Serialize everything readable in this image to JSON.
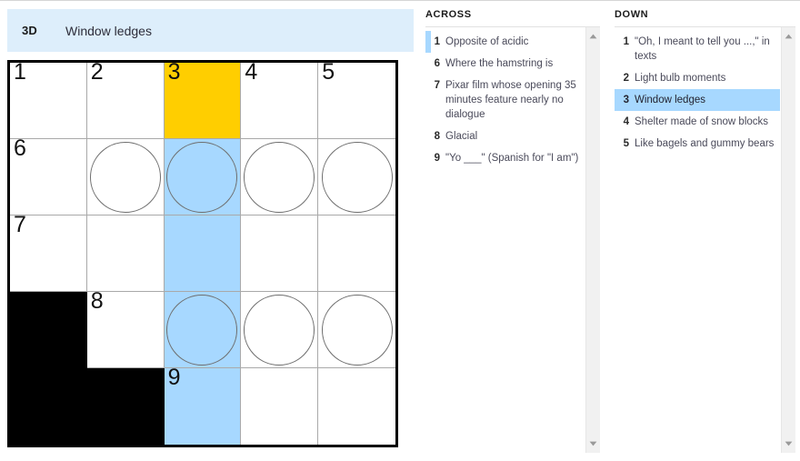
{
  "current_clue": {
    "label": "3D",
    "text": "Window ledges"
  },
  "colors": {
    "clue_bar_background": "#DDEEFB",
    "active_cell": "#FFCE00",
    "active_word": "#A7D8FF",
    "block_cell": "#000000",
    "grid_border": "#000000",
    "grid_line": "#A9A9A9"
  },
  "grid": {
    "rows": 5,
    "cols": 5,
    "cells": [
      [
        {
          "number": "1",
          "state": "open",
          "circle": false,
          "letter": ""
        },
        {
          "number": "2",
          "state": "open",
          "circle": false,
          "letter": ""
        },
        {
          "number": "3",
          "state": "active",
          "circle": false,
          "letter": ""
        },
        {
          "number": "4",
          "state": "open",
          "circle": false,
          "letter": ""
        },
        {
          "number": "5",
          "state": "open",
          "circle": false,
          "letter": ""
        }
      ],
      [
        {
          "number": "6",
          "state": "open",
          "circle": false,
          "letter": ""
        },
        {
          "number": "",
          "state": "open",
          "circle": true,
          "letter": ""
        },
        {
          "number": "",
          "state": "word",
          "circle": true,
          "letter": ""
        },
        {
          "number": "",
          "state": "open",
          "circle": true,
          "letter": ""
        },
        {
          "number": "",
          "state": "open",
          "circle": true,
          "letter": ""
        }
      ],
      [
        {
          "number": "7",
          "state": "open",
          "circle": false,
          "letter": ""
        },
        {
          "number": "",
          "state": "open",
          "circle": false,
          "letter": ""
        },
        {
          "number": "",
          "state": "word",
          "circle": false,
          "letter": ""
        },
        {
          "number": "",
          "state": "open",
          "circle": false,
          "letter": ""
        },
        {
          "number": "",
          "state": "open",
          "circle": false,
          "letter": ""
        }
      ],
      [
        {
          "number": "",
          "state": "block",
          "circle": false,
          "letter": ""
        },
        {
          "number": "8",
          "state": "open",
          "circle": false,
          "letter": ""
        },
        {
          "number": "",
          "state": "word",
          "circle": true,
          "letter": ""
        },
        {
          "number": "",
          "state": "open",
          "circle": true,
          "letter": ""
        },
        {
          "number": "",
          "state": "open",
          "circle": true,
          "letter": ""
        }
      ],
      [
        {
          "number": "",
          "state": "block",
          "circle": false,
          "letter": ""
        },
        {
          "number": "",
          "state": "block",
          "circle": false,
          "letter": ""
        },
        {
          "number": "9",
          "state": "word",
          "circle": false,
          "letter": ""
        },
        {
          "number": "",
          "state": "open",
          "circle": false,
          "letter": ""
        },
        {
          "number": "",
          "state": "open",
          "circle": false,
          "letter": ""
        }
      ]
    ]
  },
  "across": {
    "heading": "ACROSS",
    "clues": [
      {
        "number": "1",
        "text": "Opposite of acidic",
        "selected": false,
        "accented": true
      },
      {
        "number": "6",
        "text": "Where the hamstring is",
        "selected": false,
        "accented": false
      },
      {
        "number": "7",
        "text": "Pixar film whose opening 35 minutes feature nearly no dialogue",
        "selected": false,
        "accented": false
      },
      {
        "number": "8",
        "text": "Glacial",
        "selected": false,
        "accented": false
      },
      {
        "number": "9",
        "text": "\"Yo ___\" (Spanish for \"I am\")",
        "selected": false,
        "accented": false
      }
    ]
  },
  "down": {
    "heading": "DOWN",
    "clues": [
      {
        "number": "1",
        "text": "\"Oh, I meant to tell you ...,\" in texts",
        "selected": false,
        "accented": false
      },
      {
        "number": "2",
        "text": "Light bulb moments",
        "selected": false,
        "accented": false
      },
      {
        "number": "3",
        "text": "Window ledges",
        "selected": true,
        "accented": false
      },
      {
        "number": "4",
        "text": "Shelter made of snow blocks",
        "selected": false,
        "accented": false
      },
      {
        "number": "5",
        "text": "Like bagels and gummy bears",
        "selected": false,
        "accented": false
      }
    ]
  },
  "scrollbars": {
    "across": {
      "up_icon": "caret-up-icon",
      "down_icon": "caret-down-icon"
    },
    "down": {
      "up_icon": "caret-up-icon",
      "down_icon": "caret-down-icon"
    }
  }
}
